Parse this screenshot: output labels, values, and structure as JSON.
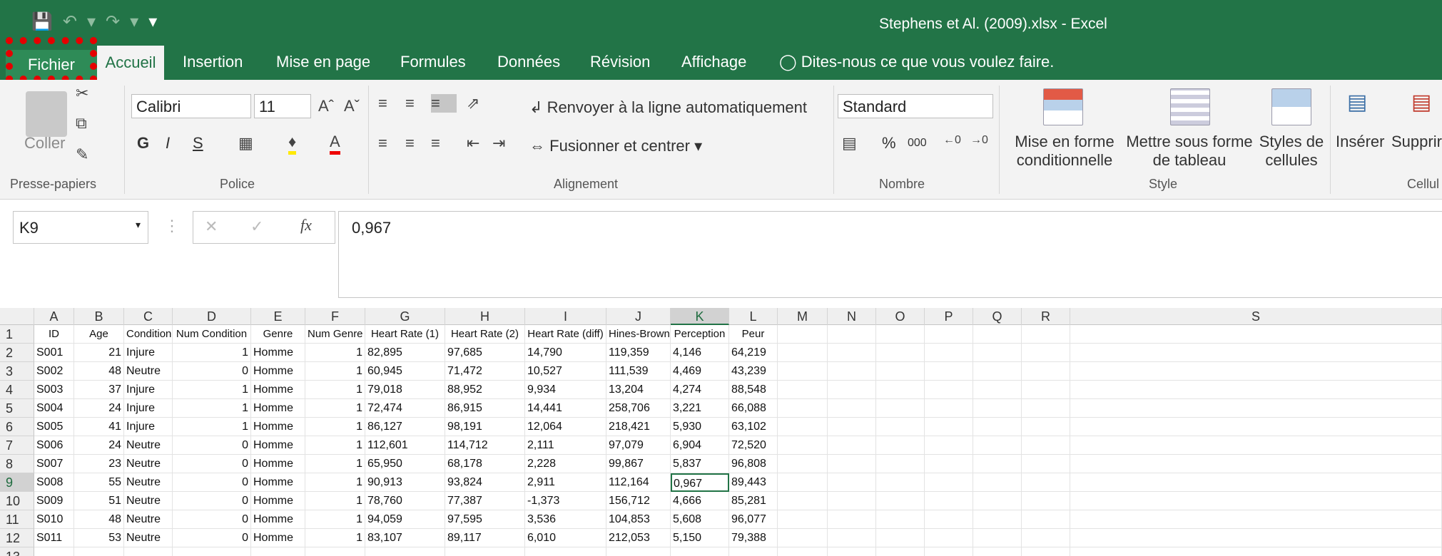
{
  "window": {
    "title": "Stephens et Al. (2009).xlsx - Excel"
  },
  "qat": {
    "save_icon": "save-icon",
    "undo_icon": "undo-icon",
    "redo_icon": "redo-icon",
    "customize_icon": "customize-icon"
  },
  "tabs": [
    {
      "label": "Fichier"
    },
    {
      "label": "Accueil"
    },
    {
      "label": "Insertion"
    },
    {
      "label": "Mise en page"
    },
    {
      "label": "Formules"
    },
    {
      "label": "Données"
    },
    {
      "label": "Révision"
    },
    {
      "label": "Affichage"
    }
  ],
  "tellme": "Dites-nous ce que vous voulez faire.",
  "ribbon": {
    "clipboard": {
      "paste": "Coller",
      "group": "Presse-papiers"
    },
    "font": {
      "name": "Calibri",
      "size": "11",
      "bold": "G",
      "italic": "I",
      "underline": "S",
      "group": "Police"
    },
    "alignment": {
      "wrap": "Renvoyer à la ligne automatiquement",
      "merge": "Fusionner et centrer",
      "group": "Alignement"
    },
    "number": {
      "format": "Standard",
      "percent": "%",
      "thousands": "000",
      "group": "Nombre"
    },
    "style": {
      "conditional_1": "Mise en forme",
      "conditional_2": "conditionnelle",
      "table_1": "Mettre sous forme",
      "table_2": "de tableau",
      "cell_1": "Styles de",
      "cell_2": "cellules",
      "group": "Style"
    },
    "cells": {
      "insert": "Insérer",
      "delete": "Supprir",
      "group": "Cellul"
    }
  },
  "formula": {
    "namebox": "K9",
    "value": "0,967",
    "fx": "fx"
  },
  "columns": [
    "A",
    "B",
    "C",
    "D",
    "E",
    "F",
    "G",
    "H",
    "I",
    "J",
    "K",
    "L",
    "M",
    "N",
    "O",
    "P",
    "Q",
    "R",
    "S"
  ],
  "headers": [
    "ID",
    "Age",
    "Condition",
    "Num Condition",
    "Genre",
    "Num Genre",
    "Heart Rate (1)",
    "Heart Rate (2)",
    "Heart Rate (diff)",
    "Hines-Brown",
    "Perception",
    "Peur"
  ],
  "rows": [
    [
      "S001",
      "21",
      "Injure",
      "1",
      "Homme",
      "1",
      "82,895",
      "97,685",
      "14,790",
      "119,359",
      "4,146",
      "64,219"
    ],
    [
      "S002",
      "48",
      "Neutre",
      "0",
      "Homme",
      "1",
      "60,945",
      "71,472",
      "10,527",
      "111,539",
      "4,469",
      "43,239"
    ],
    [
      "S003",
      "37",
      "Injure",
      "1",
      "Homme",
      "1",
      "79,018",
      "88,952",
      "9,934",
      "13,204",
      "4,274",
      "88,548"
    ],
    [
      "S004",
      "24",
      "Injure",
      "1",
      "Homme",
      "1",
      "72,474",
      "86,915",
      "14,441",
      "258,706",
      "3,221",
      "66,088"
    ],
    [
      "S005",
      "41",
      "Injure",
      "1",
      "Homme",
      "1",
      "86,127",
      "98,191",
      "12,064",
      "218,421",
      "5,930",
      "63,102"
    ],
    [
      "S006",
      "24",
      "Neutre",
      "0",
      "Homme",
      "1",
      "112,601",
      "114,712",
      "2,111",
      "97,079",
      "6,904",
      "72,520"
    ],
    [
      "S007",
      "23",
      "Neutre",
      "0",
      "Homme",
      "1",
      "65,950",
      "68,178",
      "2,228",
      "99,867",
      "5,837",
      "96,808"
    ],
    [
      "S008",
      "55",
      "Neutre",
      "0",
      "Homme",
      "1",
      "90,913",
      "93,824",
      "2,911",
      "112,164",
      "0,967",
      "89,443"
    ],
    [
      "S009",
      "51",
      "Neutre",
      "0",
      "Homme",
      "1",
      "78,760",
      "77,387",
      "-1,373",
      "156,712",
      "4,666",
      "85,281"
    ],
    [
      "S010",
      "48",
      "Neutre",
      "0",
      "Homme",
      "1",
      "94,059",
      "97,595",
      "3,536",
      "104,853",
      "5,608",
      "96,077"
    ],
    [
      "S011",
      "53",
      "Neutre",
      "0",
      "Homme",
      "1",
      "83,107",
      "89,117",
      "6,010",
      "212,053",
      "5,150",
      "79,388"
    ]
  ]
}
